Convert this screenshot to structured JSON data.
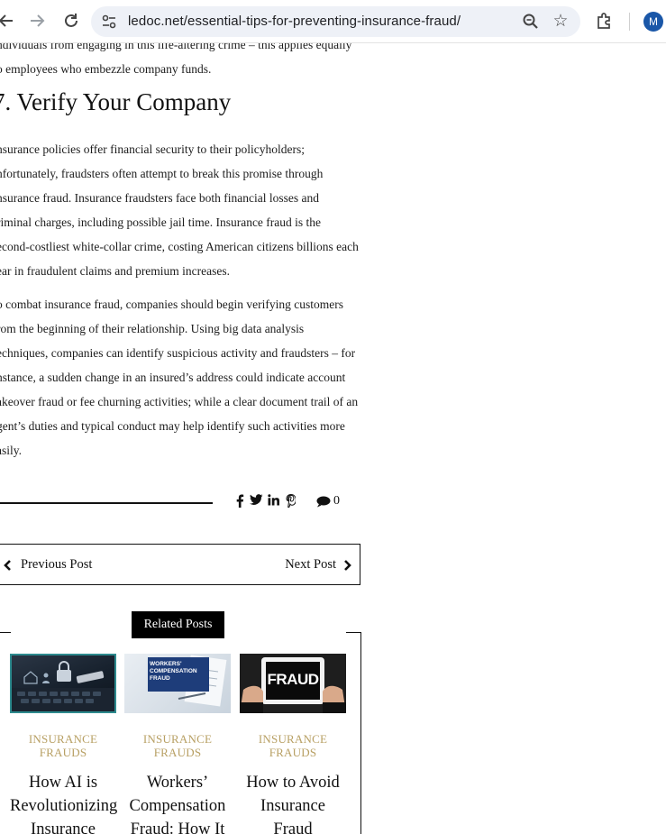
{
  "browser": {
    "url": "ledoc.net/essential-tips-for-preventing-insurance-fraud/",
    "avatar_letter": "M"
  },
  "article": {
    "intro_lines": [
      "ndividuals from engaging in this life-altering crime – this applies equally",
      "o employees who embezzle company funds."
    ],
    "heading": "7. Verify Your Company",
    "para1_lines": [
      "nsurance policies offer financial security to their policyholders;",
      "nfortunately, fraudsters often attempt to break this promise through",
      "nsurance fraud. Insurance fraudsters face both financial losses and",
      "riminal charges, including possible jail time. Insurance fraud is the",
      "econd-costliest white-collar crime, costing American citizens billions each",
      "ear in fraudulent claims and premium increases."
    ],
    "para2_lines": [
      "o combat insurance fraud, companies should begin verifying customers",
      "rom the beginning of their relationship. Using big data analysis",
      "echniques, companies can identify suspicious activity and fraudsters – for",
      "nstance, a sudden change in an insured’s address could indicate account",
      "akeover fraud or fee churning activities; while a clear document trail of an",
      "gent’s duties and typical conduct may help identify such activities more",
      "asily."
    ]
  },
  "share": {
    "icons": [
      "facebook-icon",
      "twitter-icon",
      "linkedin-icon",
      "pinterest-icon"
    ],
    "comment_count": "0"
  },
  "post_nav": {
    "previous_label": "Previous Post",
    "next_label": "Next Post"
  },
  "related": {
    "title": "Related Posts",
    "posts": [
      {
        "category_lines": [
          "INSURANCE",
          "FRAUDS"
        ],
        "title_lines": [
          "How AI is",
          "Revolutionizing",
          "Insurance"
        ]
      },
      {
        "category_lines": [
          "INSURANCE",
          "FRAUDS"
        ],
        "title_lines": [
          "Workers’",
          "Compensation",
          "Fraud: How It"
        ],
        "thumb_text": [
          "WORKERS'",
          "COMPENSATION",
          "FRAUD"
        ]
      },
      {
        "category_lines": [
          "INSURANCE",
          "FRAUDS"
        ],
        "title_lines": [
          "How to Avoid",
          "Insurance",
          "Fraud"
        ],
        "thumb_text": [
          "FRAUD"
        ]
      }
    ]
  },
  "colors": {
    "category": "#b8a064",
    "avatar": "#1a57a8"
  }
}
